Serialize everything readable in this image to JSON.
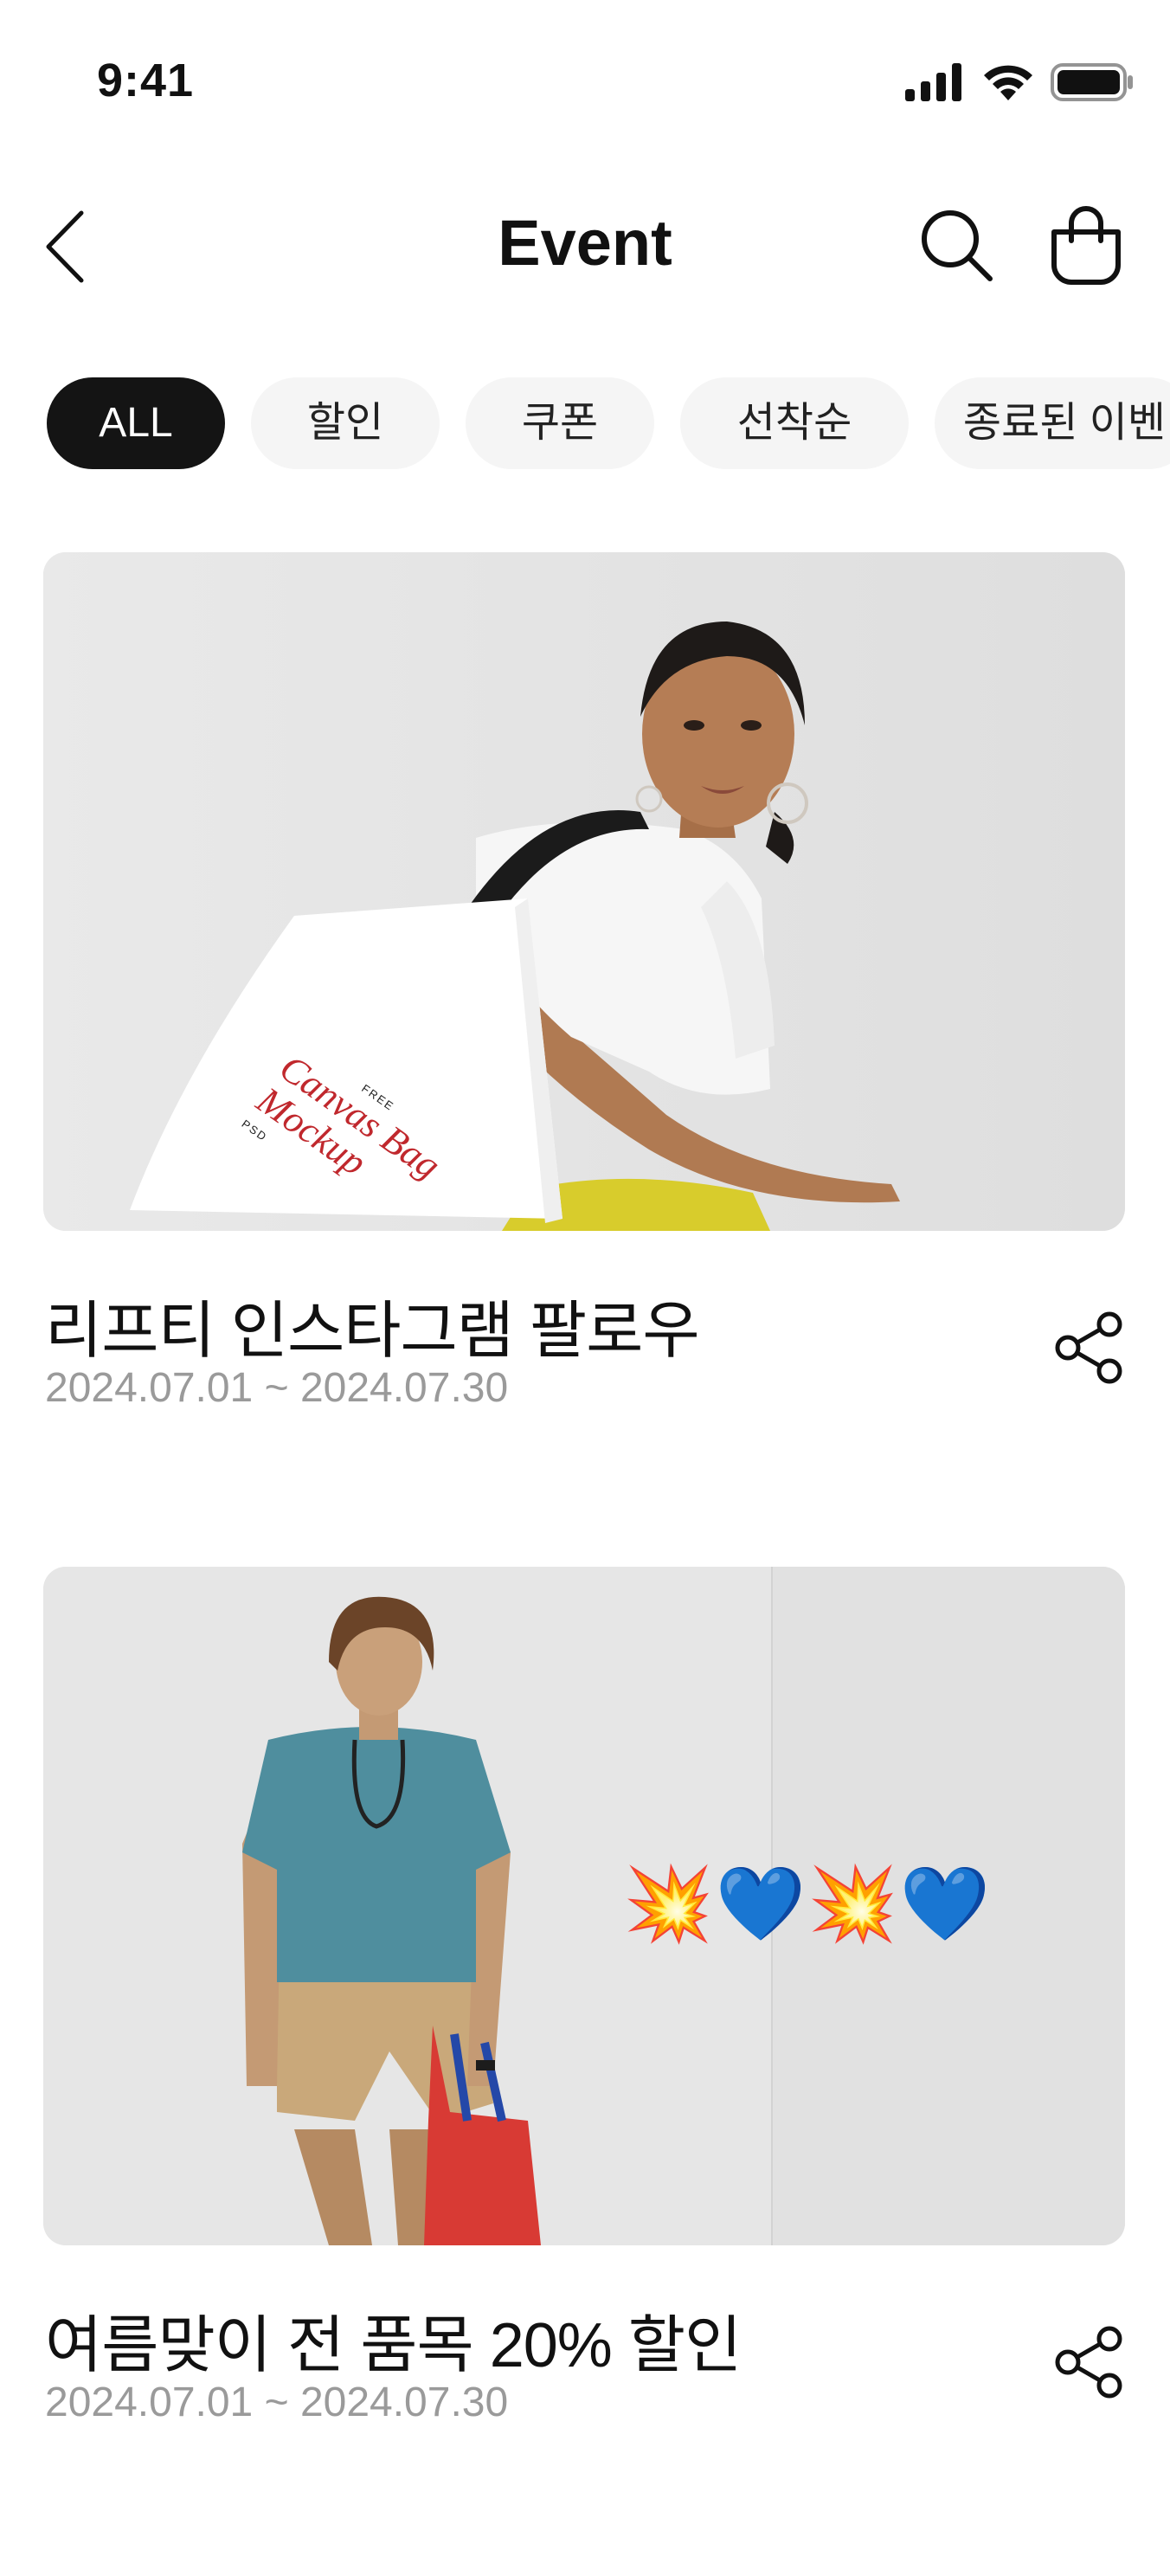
{
  "status": {
    "time": "9:41",
    "icons": [
      "signal-icon",
      "wifi-icon",
      "battery-icon"
    ]
  },
  "header": {
    "title": "Event",
    "back_icon": "chevron-left-icon",
    "search_icon": "search-icon",
    "cart_icon": "shopping-bag-icon"
  },
  "filters": [
    {
      "label": "ALL",
      "active": true
    },
    {
      "label": "할인",
      "active": false
    },
    {
      "label": "쿠폰",
      "active": false
    },
    {
      "label": "선착순",
      "active": false
    },
    {
      "label": "종료된 이벤",
      "active": false
    }
  ],
  "events": [
    {
      "title": "리프티 인스타그램 팔로우",
      "date": "2024.07.01 ~ 2024.07.30",
      "image": {
        "bag_text_1": "Canvas Bag",
        "bag_text_2": "Mockup",
        "bag_small_1": "FREE",
        "bag_small_2": "PSD"
      }
    },
    {
      "title": "여름맞이 전 품목 20% 할인",
      "date": "2024.07.01 ~ 2024.07.30",
      "image": {
        "emoji": "💥💙💥💙"
      }
    }
  ],
  "colors": {
    "accent": "#141414",
    "chip_bg": "#f5f5f5",
    "date": "#9a9a9a",
    "image_bg": "#e7e7e7"
  }
}
